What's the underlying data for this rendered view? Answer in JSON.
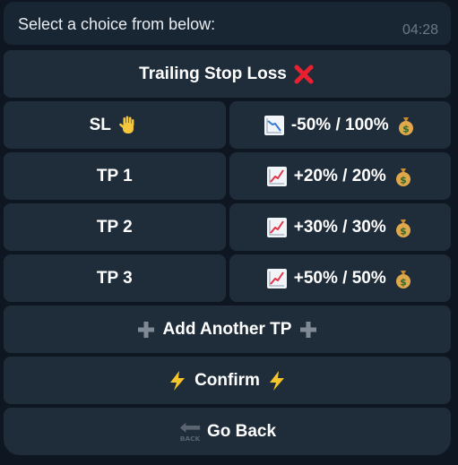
{
  "message": {
    "text": "Select a choice from below:",
    "time": "04:28"
  },
  "keyboard": {
    "trailing": {
      "label": "Trailing Stop Loss",
      "icon": "cross-mark-icon"
    },
    "sl": {
      "label": "SL",
      "icon": "raised-hand-icon"
    },
    "sl_value": {
      "label": "-50% / 100%",
      "left_icon": "chart-decreasing-icon",
      "right_icon": "money-bag-icon"
    },
    "tp1": {
      "label": "TP 1"
    },
    "tp1_value": {
      "label": "+20% / 20%",
      "left_icon": "chart-increasing-icon",
      "right_icon": "money-bag-icon"
    },
    "tp2": {
      "label": "TP 2"
    },
    "tp2_value": {
      "label": "+30% / 30%",
      "left_icon": "chart-increasing-icon",
      "right_icon": "money-bag-icon"
    },
    "tp3": {
      "label": "TP 3"
    },
    "tp3_value": {
      "label": "+50% / 50%",
      "left_icon": "chart-increasing-icon",
      "right_icon": "money-bag-icon"
    },
    "add_tp": {
      "label": "Add Another TP",
      "icon": "plus-icon"
    },
    "confirm": {
      "label": "Confirm",
      "icon": "lightning-icon"
    },
    "back": {
      "label": "Go Back",
      "icon": "back-arrow-icon"
    }
  },
  "colors": {
    "background": "#0e1621",
    "bubble": "#182533",
    "button": "#1f2d3b",
    "text": "#ffffff",
    "time": "#6c7883"
  }
}
